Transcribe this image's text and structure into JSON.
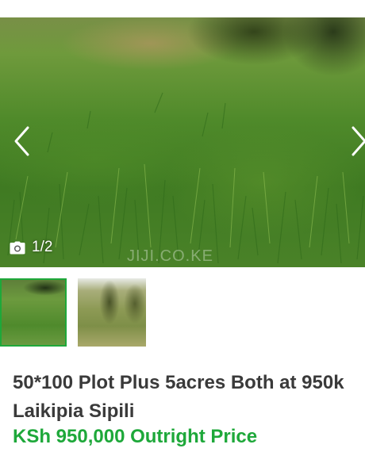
{
  "gallery": {
    "counter": "1/2",
    "watermark": "JIJI.CO.KE",
    "icons": {
      "prev": "chevron-left-icon",
      "next": "chevron-right-icon",
      "camera": "camera-icon"
    }
  },
  "thumbnails": [
    {
      "alt": "Grass field photo 1",
      "selected": true
    },
    {
      "alt": "Grass field photo 2",
      "selected": false
    }
  ],
  "listing": {
    "title": "50*100 Plot Plus 5acres Both at 950k Laikipia Sipili",
    "price": "KSh 950,000 Outright Price"
  },
  "colors": {
    "accent": "#1ea83a",
    "title_text": "#3a3a3a"
  }
}
